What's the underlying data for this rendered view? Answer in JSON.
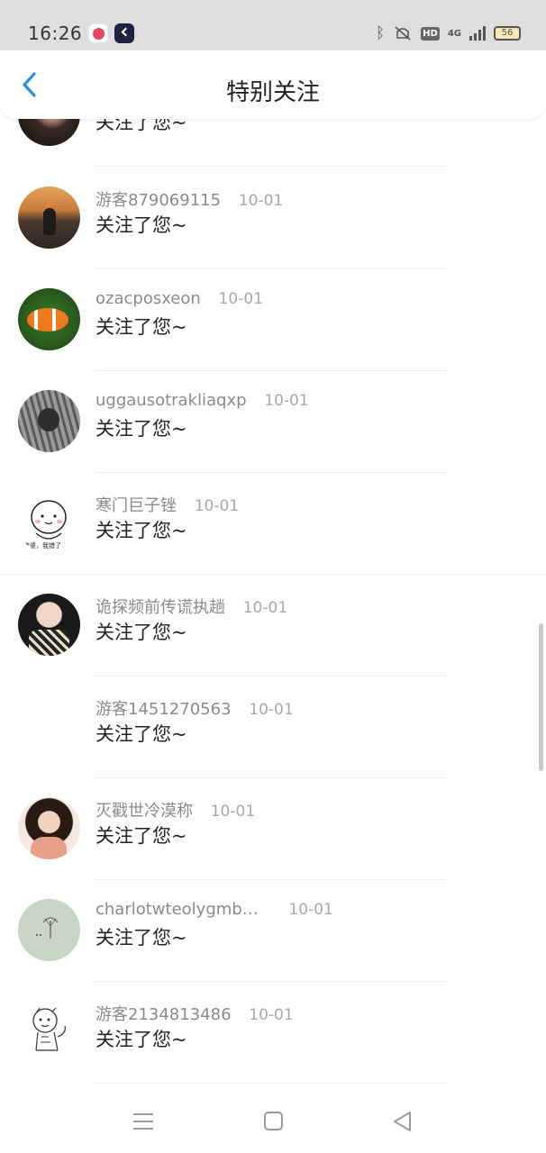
{
  "status_bar": {
    "time": "16:26",
    "battery": "56",
    "hd": "HD",
    "network": "4G"
  },
  "header": {
    "title": "特别关注",
    "back_icon": "chevron-left-icon"
  },
  "items": [
    {
      "name": "",
      "date": "",
      "action": "关注了您~"
    },
    {
      "name": "游客879069115",
      "date": "10-01",
      "action": "关注了您~"
    },
    {
      "name": "ozacposxeon",
      "date": "10-01",
      "action": "关注了您~"
    },
    {
      "name": "uggausotrakliaqxp",
      "date": "10-01",
      "action": "关注了您~"
    },
    {
      "name": "寒门巨子锉",
      "date": "10-01",
      "action": "关注了您~"
    },
    {
      "name": "诡探频前传谎执趟",
      "date": "10-01",
      "action": "关注了您~"
    },
    {
      "name": "游客1451270563",
      "date": "10-01",
      "action": "关注了您~"
    },
    {
      "name": "灭戳世冷漠称",
      "date": "10-01",
      "action": "关注了您~"
    },
    {
      "name": "charlotwteolygmb…",
      "date": "10-01",
      "action": "关注了您~"
    },
    {
      "name": "游客2134813486",
      "date": "10-01",
      "action": "关注了您~"
    }
  ],
  "avatar_badge_text": "老婆，我错了",
  "nav": {
    "menu_icon": "menu-icon",
    "home_icon": "square-icon",
    "back_icon": "triangle-back-icon"
  },
  "colors": {
    "accent": "#2f8ddf",
    "status_bar_bg": "#dedede",
    "name_gray": "#8a8a8a"
  }
}
